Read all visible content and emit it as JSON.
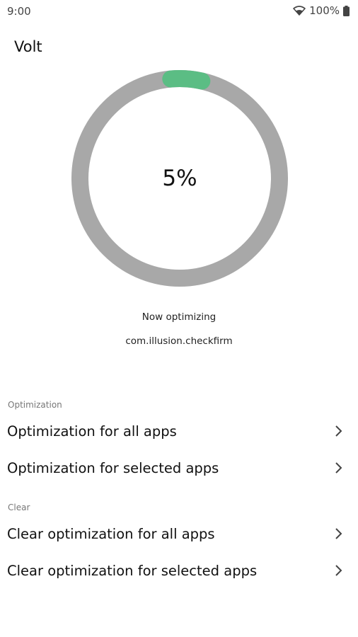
{
  "status_bar": {
    "time": "9:00",
    "battery": "100%",
    "icons": [
      "wifi-icon",
      "battery-icon"
    ]
  },
  "app": {
    "title": "Volt"
  },
  "progress": {
    "value": 5,
    "label": "5%",
    "track_color": "#a8a8a8",
    "fill_color": "#5bbd84"
  },
  "status": {
    "now_label": "Now optimizing",
    "package": "com.illusion.checkfirm"
  },
  "sections": [
    {
      "header": "Optimization",
      "items": [
        {
          "label": "Optimization for all apps",
          "icon": "chevron-right-icon"
        },
        {
          "label": "Optimization for selected apps",
          "icon": "chevron-right-icon"
        }
      ]
    },
    {
      "header": "Clear",
      "items": [
        {
          "label": "Clear optimization for all apps",
          "icon": "chevron-right-icon"
        },
        {
          "label": "Clear optimization for selected apps",
          "icon": "chevron-right-icon"
        }
      ]
    }
  ]
}
